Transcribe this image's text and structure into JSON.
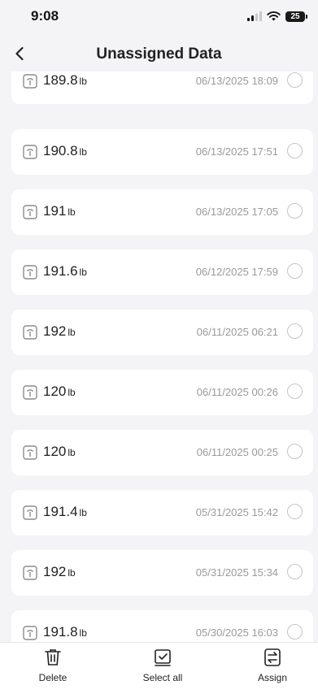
{
  "status_bar": {
    "time": "9:08",
    "battery": "25"
  },
  "header": {
    "title": "Unassigned Data"
  },
  "records": [
    {
      "weight": "189.8",
      "unit": "lb",
      "datetime": "06/13/2025 18:09"
    },
    {
      "weight": "190.8",
      "unit": "lb",
      "datetime": "06/13/2025 17:51"
    },
    {
      "weight": "191",
      "unit": "lb",
      "datetime": "06/13/2025 17:05"
    },
    {
      "weight": "191.6",
      "unit": "lb",
      "datetime": "06/12/2025 17:59"
    },
    {
      "weight": "192",
      "unit": "lb",
      "datetime": "06/11/2025 06:21"
    },
    {
      "weight": "120",
      "unit": "lb",
      "datetime": "06/11/2025 00:26"
    },
    {
      "weight": "120",
      "unit": "lb",
      "datetime": "06/11/2025 00:25"
    },
    {
      "weight": "191.4",
      "unit": "lb",
      "datetime": "05/31/2025 15:42"
    },
    {
      "weight": "192",
      "unit": "lb",
      "datetime": "05/31/2025 15:34"
    },
    {
      "weight": "191.8",
      "unit": "lb",
      "datetime": "05/30/2025 16:03"
    }
  ],
  "toolbar": {
    "delete_label": "Delete",
    "select_all_label": "Select all",
    "assign_label": "Assign"
  },
  "colors": {
    "background": "#f4f4f6",
    "card": "#ffffff",
    "muted_text": "#9a9a9a"
  }
}
